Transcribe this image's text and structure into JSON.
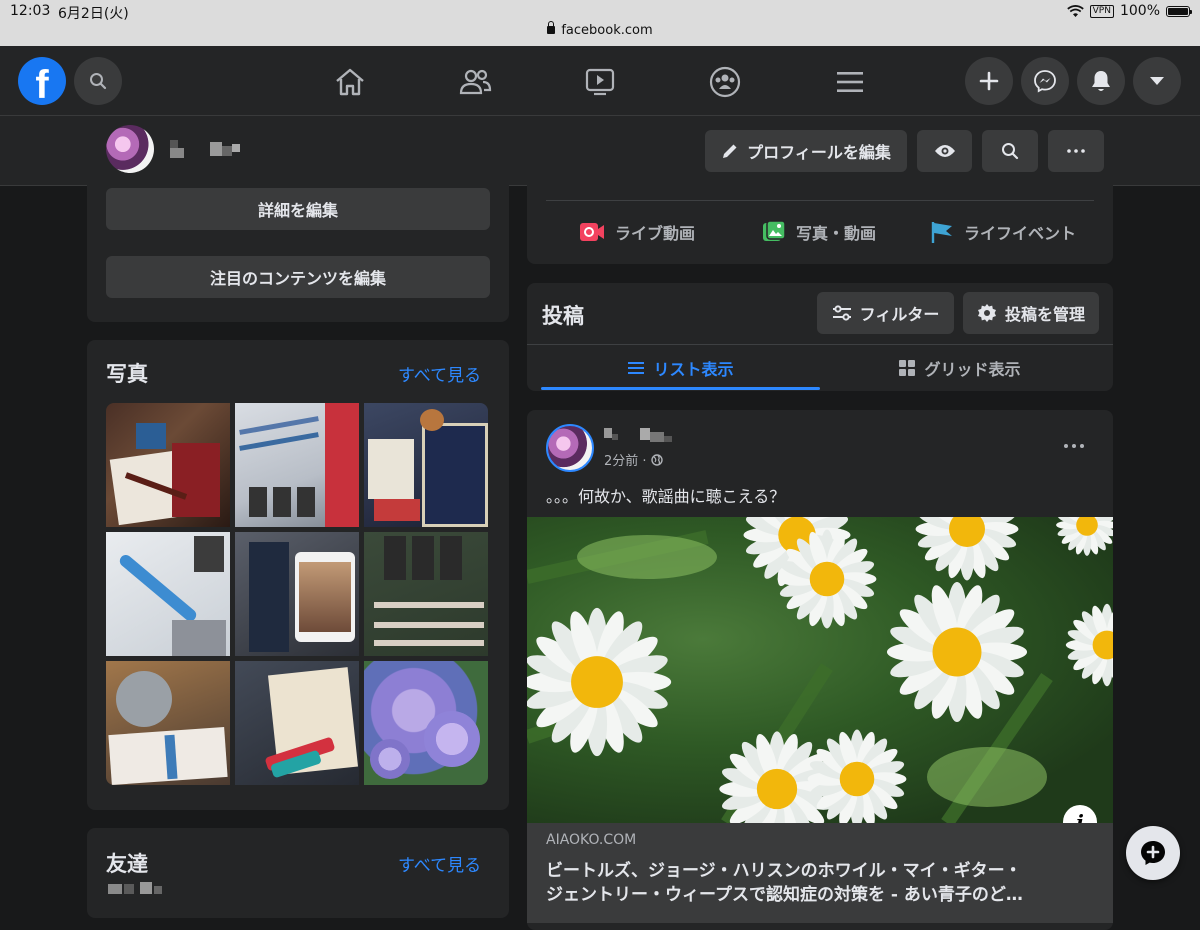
{
  "status_bar": {
    "time": "12:03",
    "date": "6月2日(火)",
    "url": "facebook.com",
    "vpn": "VPN",
    "battery": "100%",
    "battery_level": 1.0
  },
  "profile_bar": {
    "edit_profile_label": "プロフィールを編集"
  },
  "intro": {
    "edit_details_label": "詳細を編集",
    "edit_featured_label": "注目のコンテンツを編集"
  },
  "photos": {
    "title": "写真",
    "see_all": "すべて見る"
  },
  "friends": {
    "title": "友達",
    "see_all": "すべて見る"
  },
  "composer": {
    "live_label": "ライブ動画",
    "photo_label": "写真・動画",
    "life_event_label": "ライフイベント"
  },
  "posts": {
    "title": "投稿",
    "filter_label": "フィルター",
    "manage_label": "投稿を管理",
    "list_view_label": "リスト表示",
    "grid_view_label": "グリッド表示"
  },
  "post": {
    "time": "2分前 ·",
    "text": "。。。何故か、歌謡曲に聴こえる？",
    "link_domain": "AIAOKO.COM",
    "link_title_line1": "ビートルズ、ジョージ・ハリスンのホワイル・マイ・ギター・",
    "link_title_line2": "ジェントリー・ウィープスで認知症の対策を - あい青子のど…"
  },
  "colors": {
    "accent": "#2d88ff",
    "facebook_blue": "#1877f2",
    "live_red": "#f3425f",
    "photo_green": "#45bd62",
    "event_blue": "#3ea4d4",
    "background": "#18191a",
    "card": "#242526"
  }
}
